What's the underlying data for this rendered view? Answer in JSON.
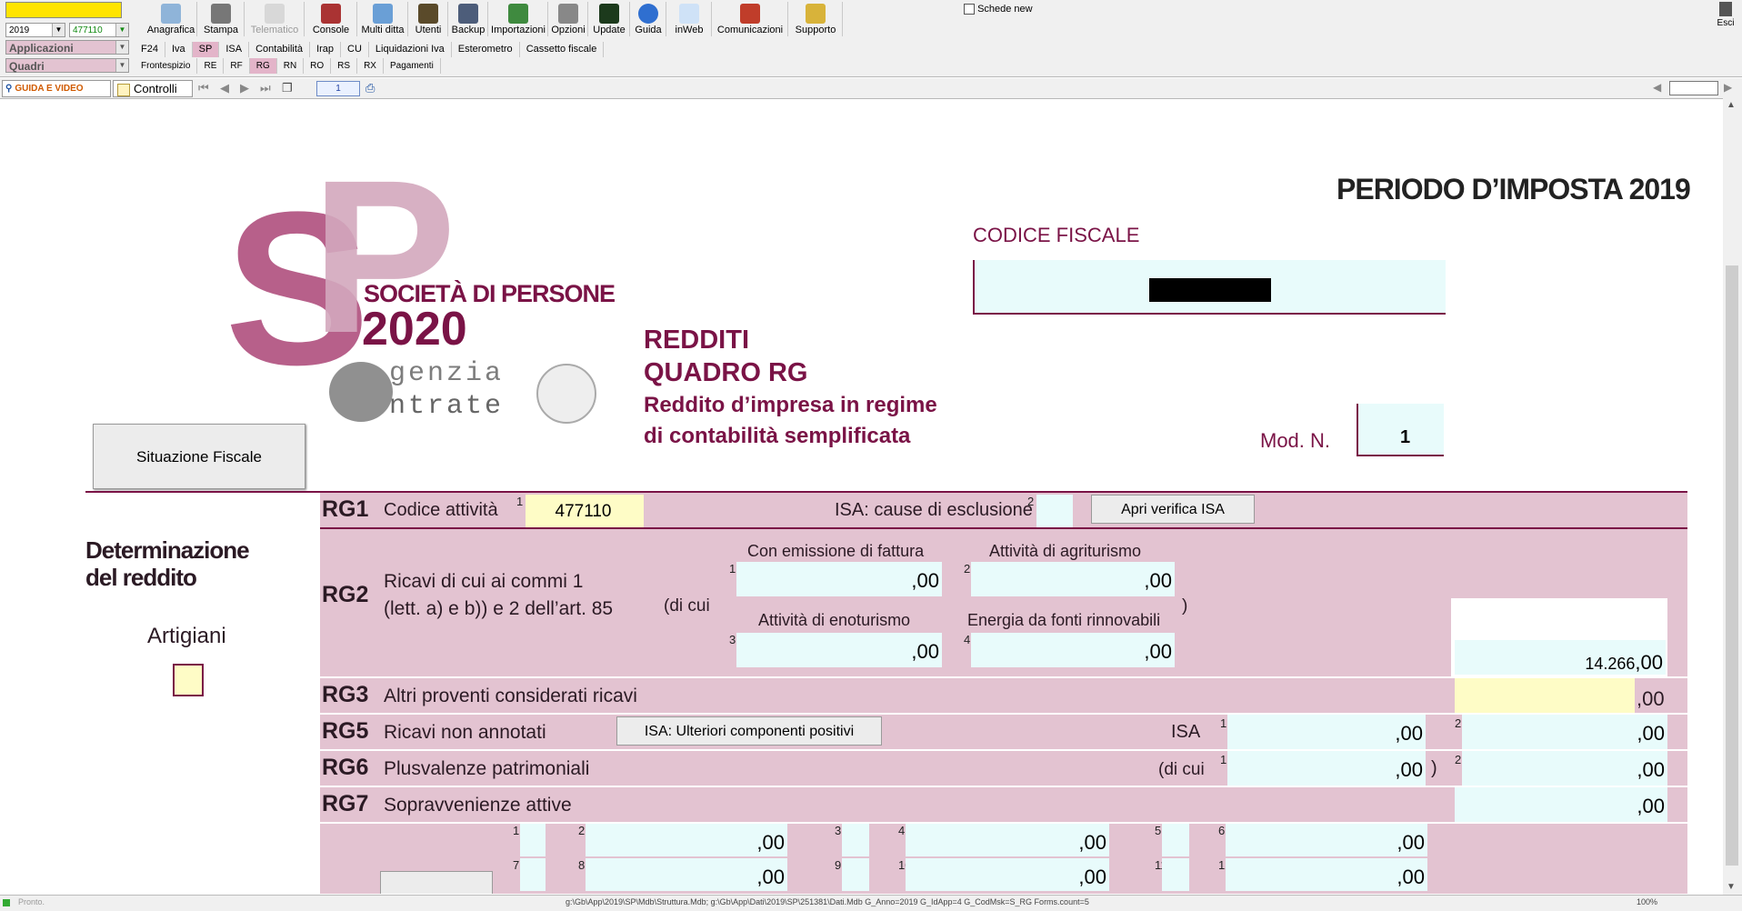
{
  "toolbar": {
    "year": "2019",
    "code": "477110",
    "applicazioni": "Applicazioni",
    "quadri": "Quadri",
    "buttons": [
      "Anagrafica",
      "Stampa",
      "Telematico",
      "Console",
      "Multi ditta",
      "Utenti",
      "Backup",
      "Importazioni",
      "Opzioni",
      "Update",
      "Guida",
      "inWeb",
      "Comunicazioni",
      "Supporto"
    ],
    "schede_new": "Schede new",
    "esci": "Esci"
  },
  "app_tabs": [
    "F24",
    "Iva",
    "SP",
    "ISA",
    "Contabilità",
    "Irap",
    "CU",
    "Liquidazioni Iva",
    "Esterometro",
    "Cassetto fiscale"
  ],
  "quadri_tabs": [
    "Frontespizio",
    "RE",
    "RF",
    "RG",
    "RN",
    "RO",
    "RS",
    "RX",
    "Pagamenti"
  ],
  "nav": {
    "guida": "GUIDA E VIDEO",
    "controlli": "Controlli",
    "page": "1"
  },
  "header": {
    "periodo": "PERIODO D’IMPOSTA 2019",
    "codice_fiscale": "CODICE FISCALE",
    "logo_sp": "SP",
    "logo_line1": "SOCIETÀ DI PERSONE",
    "logo_line2": "2020",
    "agenzia1": "genzia",
    "agenzia2": "ntrate",
    "redditi": "REDDITI",
    "quadro": "QUADRO RG",
    "desc1": "Reddito d’impresa in regime",
    "desc2": "di contabilità semplificata",
    "mod_label": "Mod. N.",
    "mod_value": "1"
  },
  "left": {
    "situazione": "Situazione Fiscale",
    "det1": "Determinazione",
    "det2": "del reddito",
    "artigiani": "Artigiani"
  },
  "rows": {
    "rg1": {
      "code": "RG1",
      "label": "Codice attività",
      "value": "477110",
      "isa_label": "ISA: cause di esclusione",
      "btn": "Apri verifica ISA"
    },
    "rg2": {
      "code": "RG2",
      "label1": "Ricavi di cui ai commi 1",
      "label2": "(lett. a) e b)) e 2 dell’art. 85",
      "dicui": "(di cui",
      "c1": "Con emissione di fattura",
      "c2": "Attività di agriturismo",
      "c3": "Attività di enoturismo",
      "c4": "Energia da fonti rinnovabili",
      "total": "14.266"
    },
    "rg3": {
      "code": "RG3",
      "label": "Altri proventi considerati ricavi"
    },
    "rg5": {
      "code": "RG5",
      "label": "Ricavi non annotati",
      "btn": "ISA: Ulteriori componenti positivi",
      "isa": "ISA"
    },
    "rg6": {
      "code": "RG6",
      "label": "Plusvalenze patrimoniali",
      "dicui": "(di cui"
    },
    "rg7": {
      "code": "RG7",
      "label": "Sopravvenienze attive"
    },
    "cents": ",00"
  },
  "status": {
    "left": "Pronto.",
    "path": "g:\\Gb\\App\\2019\\SP\\Mdb\\Struttura.Mdb; g:\\Gb\\App\\Dati\\2019\\SP\\251381\\Dati.Mdb G_Anno=2019 G_IdApp=4 G_CodMsk=S_RG Forms.count=5",
    "zoom": "100%"
  }
}
